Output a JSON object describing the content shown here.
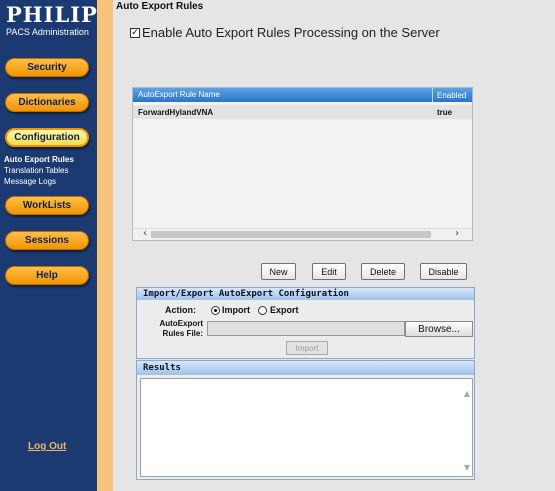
{
  "brand": {
    "logo": "PHILIPS",
    "app_title": "PACS Administration"
  },
  "nav": {
    "security": "Security",
    "dictionaries": "Dictionaries",
    "configuration": "Configuration",
    "config_links": [
      "Auto Export Rules",
      "Translation Tables",
      "Message Logs"
    ],
    "worklists": "WorkLists",
    "sessions": "Sessions",
    "help": "Help",
    "logout": "Log Out"
  },
  "page": {
    "heading": "Auto Export Rules",
    "enable_checkbox_checked": true,
    "enable_label": "Enable Auto Export Rules Processing on the Server"
  },
  "rules_table": {
    "columns": [
      "AutoExport Rule Name",
      "Enabled"
    ],
    "rows": [
      {
        "name": "ForwardHylandVNA",
        "enabled": "true"
      }
    ]
  },
  "actions": {
    "new": "New",
    "edit": "Edit",
    "delete": "Delete",
    "disable": "Disable"
  },
  "import_export": {
    "title": "Import/Export AutoExport Configuration",
    "action_label": "Action:",
    "import_option": "Import",
    "export_option": "Export",
    "selected": "Import",
    "file_label_line1": "AutoExport",
    "file_label_line2": "Rules File:",
    "browse": "Browse...",
    "import_button": "Import"
  },
  "results": {
    "title": "Results",
    "text": ""
  },
  "colors": {
    "sidebar": "#1c3a72",
    "accent": "#f39300",
    "table_header": "#2c73c6"
  }
}
